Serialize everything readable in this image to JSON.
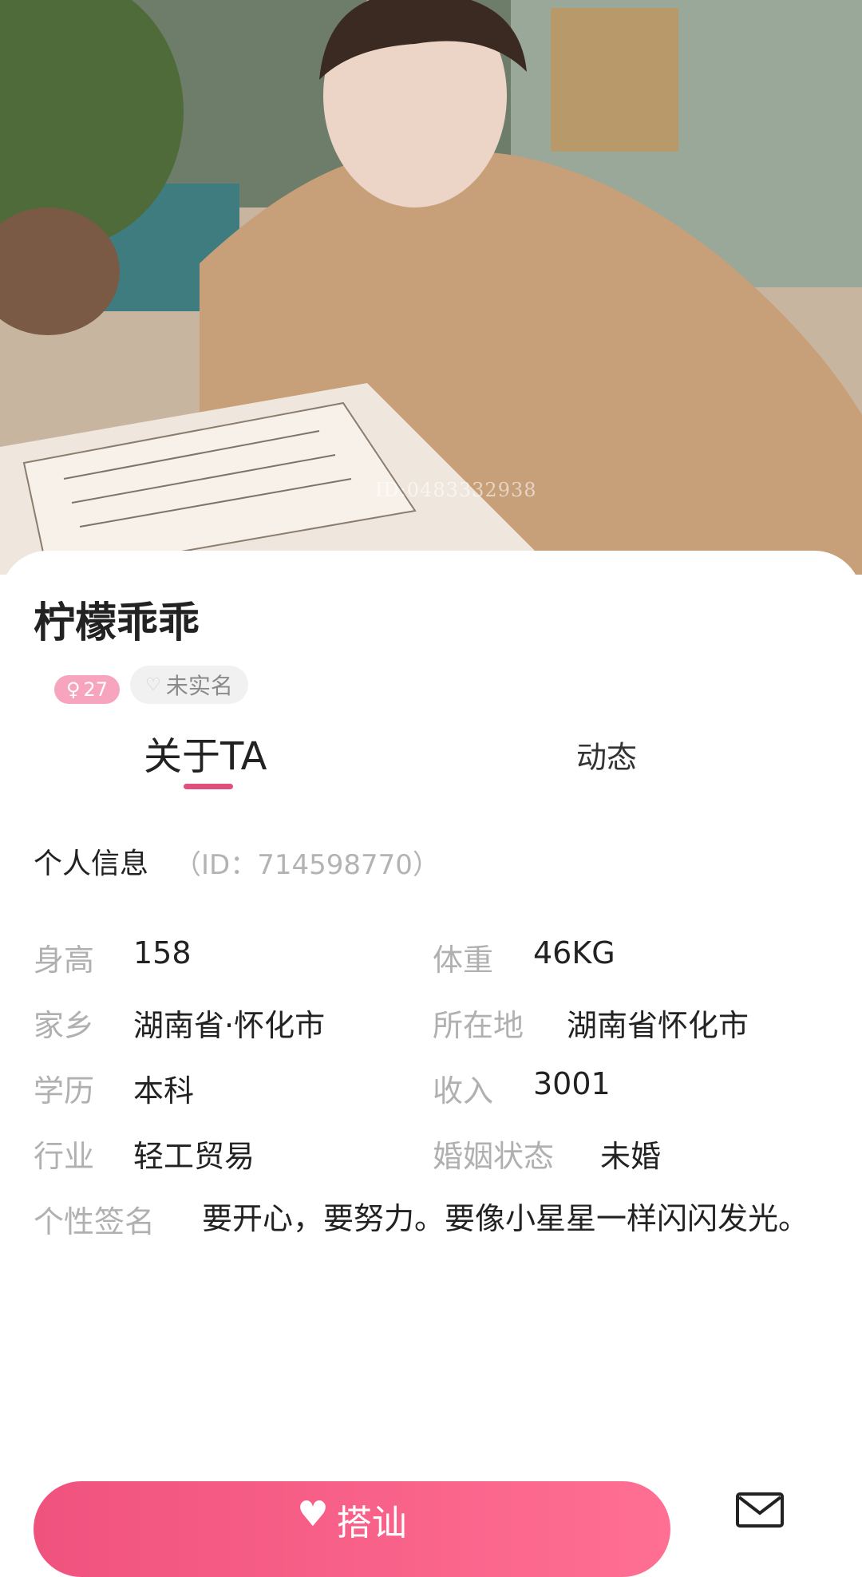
{
  "profile": {
    "name": "柠檬乖乖",
    "age": "27",
    "verify_label": "未实名",
    "watermark": "ID:0483332938"
  },
  "tabs": [
    {
      "label": "关于TA",
      "active": true
    },
    {
      "label": "动态",
      "active": false
    }
  ],
  "info": {
    "section_title": "个人信息",
    "id_text": "（ID：714598770）",
    "rows": [
      {
        "label": "身高",
        "value": "158"
      },
      {
        "label": "体重",
        "value": "46KG"
      },
      {
        "label": "家乡",
        "value": "湖南省·怀化市"
      },
      {
        "label": "所在地",
        "value": "湖南省怀化市"
      },
      {
        "label": "学历",
        "value": "本科"
      },
      {
        "label": "收入",
        "value": "3001"
      },
      {
        "label": "行业",
        "value": "轻工贸易"
      },
      {
        "label": "婚姻状态",
        "value": "未婚"
      }
    ],
    "signature_label": "个性签名",
    "signature": "要开心，要努力。要像小星星一样闪闪发光。"
  },
  "actions": {
    "cta_label": "搭讪",
    "cta_icon": "heart-icon",
    "mail_icon": "mail-icon"
  },
  "colors": {
    "accent": "#f0527e",
    "underline": "#e0507c",
    "label_gray": "#b0b0b0"
  }
}
